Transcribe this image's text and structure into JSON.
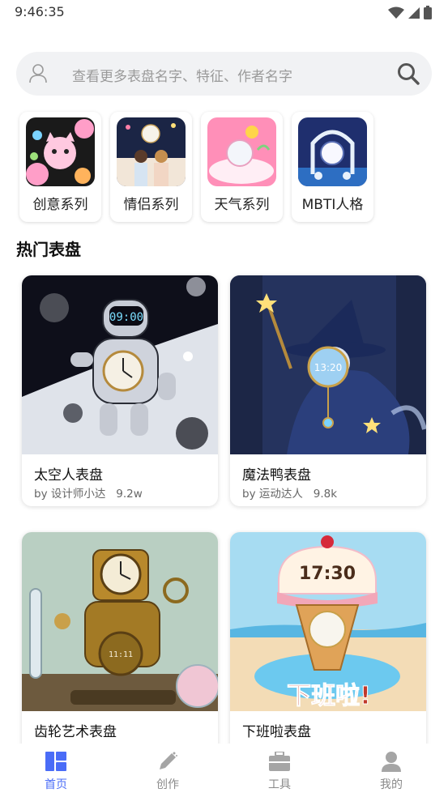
{
  "status_bar": {
    "time": "9:46:35"
  },
  "search": {
    "placeholder": "查看更多表盘名字、特征、作者名字"
  },
  "categories": [
    {
      "label": "创意系列",
      "icon": "cat-balloon-icon"
    },
    {
      "label": "情侣系列",
      "icon": "couple-icon"
    },
    {
      "label": "天气系列",
      "icon": "weather-icon"
    },
    {
      "label": "MBTI人格",
      "icon": "mbti-icon"
    }
  ],
  "section": {
    "title": "热门表盘"
  },
  "cards": [
    {
      "name": "太空人表盘",
      "meta": "by 设计师小达   9.2w",
      "clock": "09:00"
    },
    {
      "name": "魔法鸭表盘",
      "meta": "by 运动达人   9.8k",
      "clock": "13:20"
    },
    {
      "name": "齿轮艺术表盘",
      "meta": "",
      "clock": "11:11"
    },
    {
      "name": "下班啦表盘",
      "meta": "",
      "clock": "17:30",
      "banner": "下班啦!"
    }
  ],
  "tabbar": [
    {
      "label": "首页",
      "icon": "home-grid-icon",
      "active": true
    },
    {
      "label": "创作",
      "icon": "pencil-icon",
      "active": false
    },
    {
      "label": "工具",
      "icon": "toolbox-icon",
      "active": false
    },
    {
      "label": "我的",
      "icon": "profile-icon",
      "active": false
    }
  ],
  "colors": {
    "accent": "#4a6cf7",
    "search_bg": "#f1f2f4"
  }
}
